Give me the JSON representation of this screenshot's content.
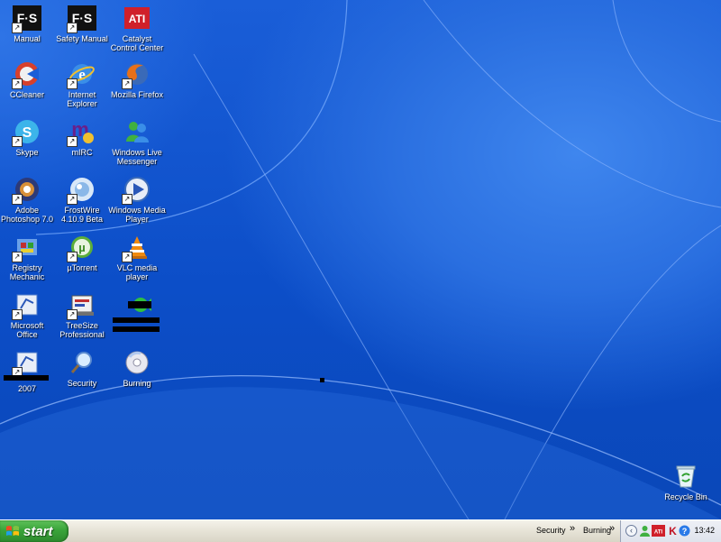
{
  "desktop": {
    "icons": [
      {
        "label": "Manual",
        "icon": "fs-icon"
      },
      {
        "label": "Safety Manual",
        "icon": "fs-icon"
      },
      {
        "label": "Catalyst\nControl Center",
        "icon": "ati-icon"
      },
      {
        "label": "CCleaner",
        "icon": "ccleaner-icon"
      },
      {
        "label": "Internet\nExplorer",
        "icon": "internet-explorer-icon"
      },
      {
        "label": "Mozilla Firefox",
        "icon": "firefox-icon"
      },
      {
        "label": "Skype",
        "icon": "skype-icon"
      },
      {
        "label": "mIRC",
        "icon": "mirc-icon"
      },
      {
        "label": "Windows Live\nMessenger",
        "icon": "messenger-icon"
      },
      {
        "label": "Adobe\nPhotoshop 7.0",
        "icon": "photoshop-icon"
      },
      {
        "label": "FrostWire\n4.10.9 Beta",
        "icon": "frostwire-icon"
      },
      {
        "label": "Windows Media\nPlayer",
        "icon": "media-player-icon"
      },
      {
        "label": "Registry\nMechanic",
        "icon": "registry-mechanic-icon"
      },
      {
        "label": "µTorrent",
        "icon": "utorrent-icon"
      },
      {
        "label": "VLC media\nplayer",
        "icon": "vlc-icon"
      },
      {
        "label": "Microsoft\nOffice",
        "icon": "office-folder-icon"
      },
      {
        "label": "TreeSize\nProfessional",
        "icon": "treesize-icon"
      },
      {
        "label": "",
        "icon": "redacted-icon"
      },
      {
        "label": "2007",
        "icon": "office-folder-icon"
      },
      {
        "label": "Security",
        "icon": "magnifier-icon"
      },
      {
        "label": "Burning",
        "icon": "cd-icon"
      }
    ],
    "recycle_bin": {
      "label": "Recycle Bin",
      "icon": "recycle-bin-icon"
    }
  },
  "taskbar": {
    "start_label": "start",
    "toolbar_items": [
      "Security",
      "Burning"
    ],
    "chevron": "»",
    "clock": "13:42"
  },
  "colors": {
    "desktop_blue": "#0a4fc9",
    "start_green": "#3aa43a",
    "taskbar": "#e9e6da"
  }
}
